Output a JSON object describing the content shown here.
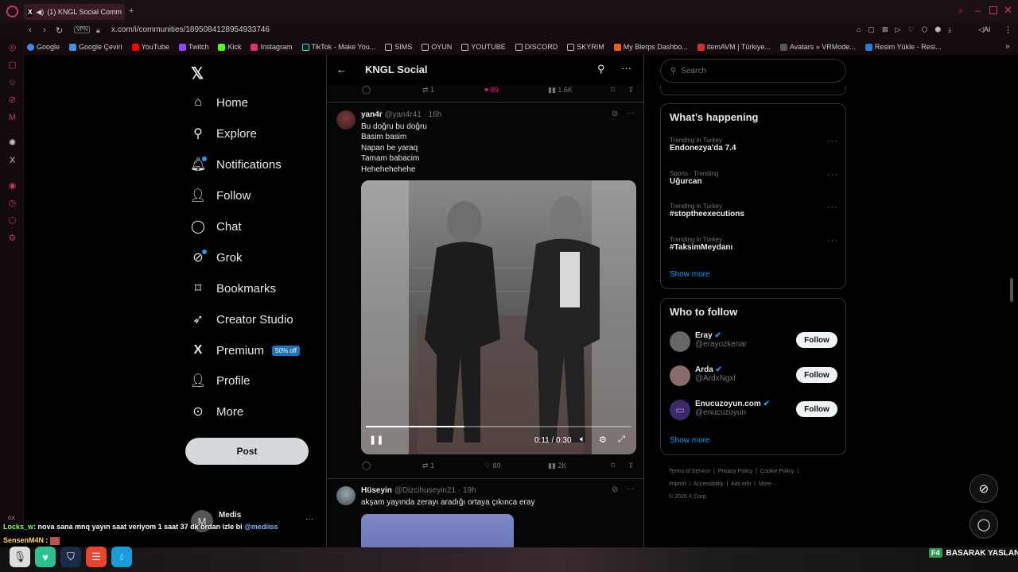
{
  "browser": {
    "tab_title": "(1) KNGL Social Comm",
    "url": "x.com/i/communities/1895084128954933746",
    "vpn_label": "VPN",
    "ai_label": "AI",
    "bookmarks": [
      "Google",
      "Google Çeviri",
      "YouTube",
      "Twitch",
      "Kick",
      "Instagram",
      "TikTok - Make You...",
      "SIMS",
      "OYUN",
      "YOUTUBE",
      "DISCORD",
      "SKYRIM",
      "My Blerps Dashbo...",
      "itemAVM | Türkiye...",
      "Avatars » VRMode...",
      "Resim Yükle - Resi..."
    ]
  },
  "nav": {
    "items": [
      "Home",
      "Explore",
      "Notifications",
      "Follow",
      "Chat",
      "Grok",
      "Bookmarks",
      "Creator Studio",
      "Premium",
      "Profile",
      "More"
    ],
    "premium_badge": "50% off",
    "post_button": "Post",
    "account_name": "Medis",
    "account_initial": "M"
  },
  "community": {
    "title": "KNGL Social"
  },
  "top_actions": {
    "retweets": "1",
    "likes": "89",
    "views": "1.6K"
  },
  "tweet1": {
    "name": "yan4r",
    "handle": "@yan4r41",
    "time": "· 16h",
    "lines": [
      "Bu doğru bu doğru",
      "Basim basim",
      "Napan be yaraq",
      "Tamam babacim",
      "Hehehehehehe"
    ],
    "video_time": "0:11 / 0:30",
    "video_progress": 0.37,
    "retweets": "1",
    "likes": "89",
    "views": "2K"
  },
  "tweet2": {
    "name": "Hüseyin",
    "handle": "@Dizcihuseyin21",
    "time": "· 19h",
    "text": "akşam yayında zerayı aradığı ortaya çıkınca eray"
  },
  "search": {
    "placeholder": "Search"
  },
  "happening": {
    "title": "What’s happening",
    "trends": [
      {
        "context": "Trending in Turkey",
        "name": "Endonezya'da 7.4"
      },
      {
        "context": "Sports · Trending",
        "name": "Uğurcan"
      },
      {
        "context": "Trending in Turkey",
        "name": "#stoptheexecutions"
      },
      {
        "context": "Trending in Turkey",
        "name": "#TaksimMeydanı"
      }
    ],
    "show_more": "Show more"
  },
  "who_to_follow": {
    "title": "Who to follow",
    "users": [
      {
        "name": "Eray",
        "handle": "@erayozkenar",
        "button": "Follow"
      },
      {
        "name": "Arda",
        "handle": "@ArdxNgxl",
        "button": "Follow"
      },
      {
        "name": "Enucuzoyun.com",
        "handle": "@enucuzoyun",
        "button": "Follow"
      }
    ],
    "show_more": "Show more"
  },
  "footer": {
    "links": [
      "Terms of Service",
      "Privacy Policy",
      "Cookie Policy",
      "Imprint",
      "Accessibility",
      "Ads info",
      "More ···"
    ],
    "copyright": "© 2026 X Corp."
  },
  "overlay": {
    "chat1_user": "Locks_w",
    "chat1_text": ": nova sana mnq yayın saat veriyom 1 saat 37 dk ordan izle bi",
    "chat1_mention": "@mediiss",
    "chat2_user": "SensenM4N",
    "chat2_text": ":",
    "gx_label": "GX",
    "f4_key": "F4",
    "f4_text": "BASARAK YASLAN"
  },
  "colors": {
    "accent": "#1d9bf0",
    "like": "#f91880",
    "opera_red": "#c63b55"
  }
}
